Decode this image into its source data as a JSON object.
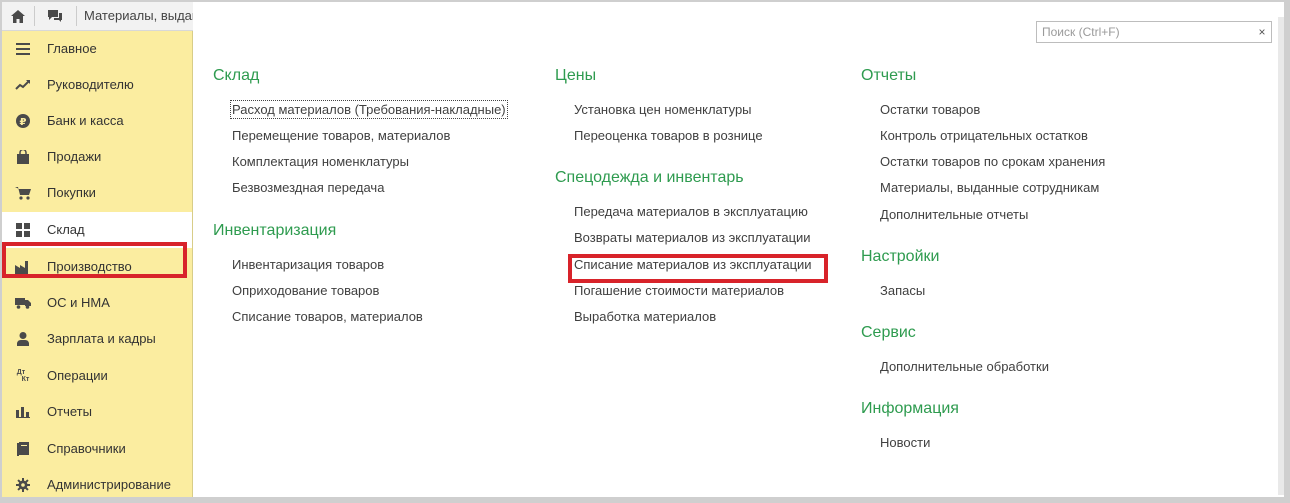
{
  "window": {
    "title": "Материалы, выданные сотрудникам",
    "home_icon": "home-icon",
    "chat_icon": "chat-icon"
  },
  "search": {
    "placeholder": "Поиск (Ctrl+F)",
    "value": "",
    "clear_label": "×"
  },
  "sidebar": {
    "active_index": 5,
    "items": [
      {
        "label": "Главное",
        "icon": "menu-lines-icon"
      },
      {
        "label": "Руководителю",
        "icon": "trend-icon"
      },
      {
        "label": "Банк и касса",
        "icon": "coin-icon"
      },
      {
        "label": "Продажи",
        "icon": "bag-icon"
      },
      {
        "label": "Покупки",
        "icon": "cart-icon"
      },
      {
        "label": "Склад",
        "icon": "grid-icon"
      },
      {
        "label": "Производство",
        "icon": "factory-icon"
      },
      {
        "label": "ОС и НМА",
        "icon": "truck-icon"
      },
      {
        "label": "Зарплата и кадры",
        "icon": "person-icon"
      },
      {
        "label": "Операции",
        "icon": "dt-kt-icon",
        "icon_text_top": "Дт",
        "icon_text_bottom": "Кт"
      },
      {
        "label": "Отчеты",
        "icon": "bar-chart-icon"
      },
      {
        "label": "Справочники",
        "icon": "book-icon"
      },
      {
        "label": "Администрирование",
        "icon": "gear-icon"
      }
    ]
  },
  "sections": {
    "sklad": {
      "title": "Склад",
      "links": [
        "Расход материалов (Требования-накладные)",
        "Перемещение товаров, материалов",
        "Комплектация номенклатуры",
        "Безвозмездная передача"
      ]
    },
    "inventarizaciya": {
      "title": "Инвентаризация",
      "links": [
        "Инвентаризация товаров",
        "Оприходование товаров",
        "Списание товаров, материалов"
      ]
    },
    "ceny": {
      "title": "Цены",
      "links": [
        "Установка цен номенклатуры",
        "Переоценка товаров в рознице"
      ]
    },
    "specodezhda": {
      "title": "Спецодежда и инвентарь",
      "links": [
        "Передача материалов в эксплуатацию",
        "Возвраты материалов из эксплуатации",
        "Списание материалов из эксплуатации",
        "Погашение стоимости материалов",
        "Выработка материалов"
      ]
    },
    "otchety": {
      "title": "Отчеты",
      "links": [
        "Остатки товаров",
        "Контроль отрицательных остатков",
        "Остатки товаров по срокам хранения",
        "Материалы, выданные сотрудникам",
        "Дополнительные отчеты"
      ]
    },
    "nastroyki": {
      "title": "Настройки",
      "links": [
        "Запасы"
      ]
    },
    "servis": {
      "title": "Сервис",
      "links": [
        "Дополнительные обработки"
      ]
    },
    "informaciya": {
      "title": "Информация",
      "links": [
        "Новости"
      ]
    }
  },
  "colors": {
    "sidebar_bg": "#fbeda0",
    "section_title": "#2e9b4f",
    "highlight": "#d8232a"
  }
}
